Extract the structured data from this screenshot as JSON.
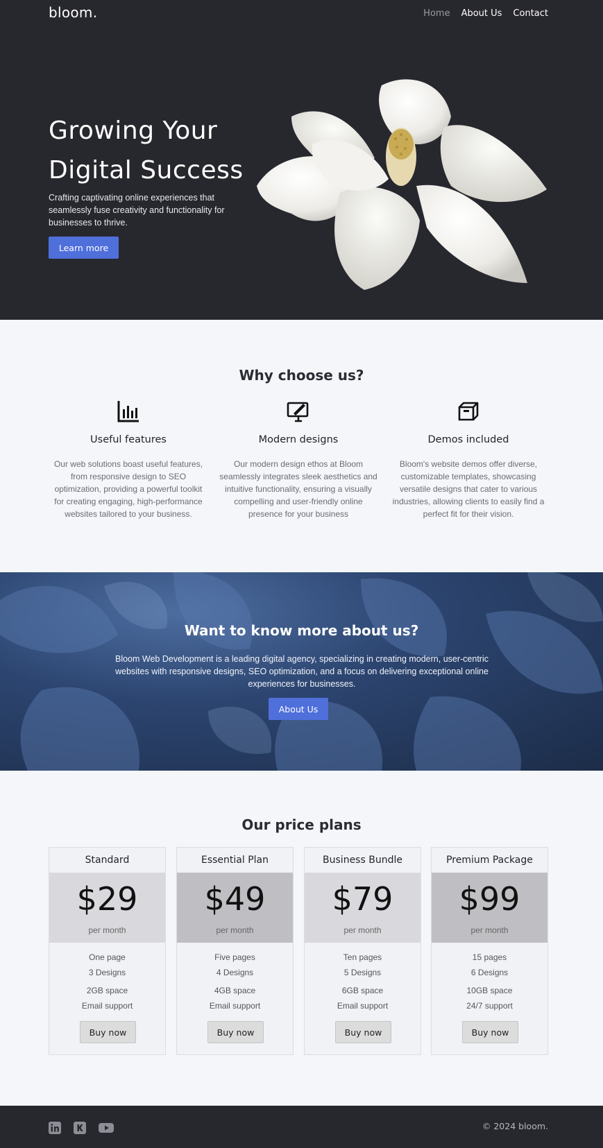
{
  "brand": {
    "logo": "bloom."
  },
  "nav": {
    "items": [
      {
        "label": "Home"
      },
      {
        "label": "About Us"
      },
      {
        "label": "Contact"
      }
    ]
  },
  "hero": {
    "title": "Growing Your Digital Success",
    "text": "Crafting captivating online experiences that seamlessly fuse creativity and functionality for businesses to thrive.",
    "cta": "Learn more",
    "image_icon": "magnolia-flower-image"
  },
  "why": {
    "title": "Why choose us?",
    "features": [
      {
        "icon": "bar-chart-icon",
        "title": "Useful features",
        "text": "Our web solutions boast useful features, from responsive design to SEO optimization, providing a powerful toolkit for creating engaging, high-performance websites tailored to your business."
      },
      {
        "icon": "monitor-pen-icon",
        "title": "Modern designs",
        "text": "Our modern design ethos at Bloom seamlessly integrates sleek aesthetics and intuitive functionality, ensuring a visually compelling and user-friendly online presence for your business"
      },
      {
        "icon": "box-icon",
        "title": "Demos included",
        "text": "Bloom's website demos offer diverse, customizable templates, showcasing versatile designs that cater to various industries, allowing clients to easily find a perfect fit for their vision."
      }
    ]
  },
  "about": {
    "title": "Want to know more about us?",
    "text": "Bloom Web Development is a leading digital agency, specializing in creating modern, user-centric websites with responsive designs, SEO optimization, and a focus on delivering exceptional online experiences for businesses.",
    "cta": "About Us"
  },
  "pricing": {
    "title": "Our price plans",
    "plans": [
      {
        "name": "Standard",
        "price": "$29",
        "period": "per month",
        "features": [
          "One page",
          "3 Designs",
          "2GB space",
          "Email support"
        ],
        "button": "Buy now",
        "price_bg": "#d9d9dd"
      },
      {
        "name": "Essential Plan",
        "price": "$49",
        "period": "per month",
        "features": [
          "Five pages",
          "4 Designs",
          "4GB space",
          "Email support"
        ],
        "button": "Buy now",
        "price_bg": "#bfbfc3"
      },
      {
        "name": "Business Bundle",
        "price": "$79",
        "period": "per month",
        "features": [
          "Ten pages",
          "5 Designs",
          "6GB space",
          "Email support"
        ],
        "button": "Buy now",
        "price_bg": "#d9d9dd"
      },
      {
        "name": "Premium Package",
        "price": "$99",
        "period": "per month",
        "features": [
          "15 pages",
          "6 Designs",
          "10GB space",
          "24/7 support"
        ],
        "button": "Buy now",
        "price_bg": "#bfbfc3"
      }
    ]
  },
  "footer": {
    "socials": [
      {
        "icon": "linkedin-icon"
      },
      {
        "icon": "kickstarter-icon"
      },
      {
        "icon": "youtube-icon"
      }
    ],
    "copyright": "© 2024 bloom."
  },
  "colors": {
    "dark": "#27272e",
    "accent": "#4f6fdb",
    "page_bg": "#f4f6fa"
  }
}
